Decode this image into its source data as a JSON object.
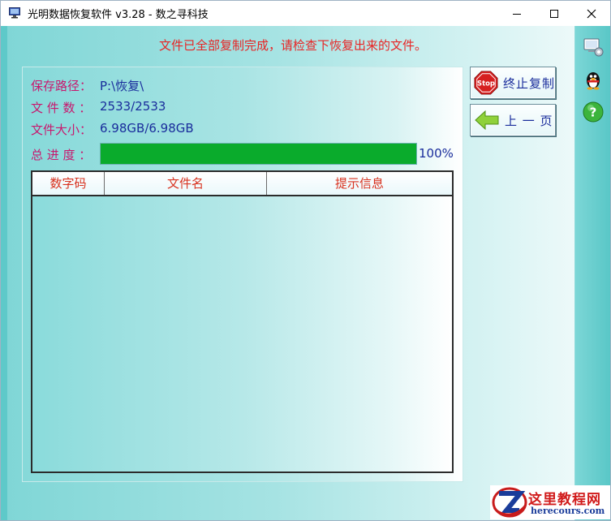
{
  "window": {
    "title": "光明数据恢复软件 v3.28 - 数之寻科技"
  },
  "status_message": "文件已全部复制完成，请检查下恢复出来的文件。",
  "info": {
    "save_path_label": "保存路径：",
    "save_path_value": "P:\\恢复\\",
    "file_count_label": "文 件 数 ：",
    "file_count_value": "2533/2533",
    "file_size_label": "文件大小：",
    "file_size_value": "6.98GB/6.98GB",
    "progress_label": "总 进 度 ：",
    "progress_percent": 100,
    "progress_text": "100%"
  },
  "table": {
    "columns": [
      "数字码",
      "文件名",
      "提示信息"
    ],
    "rows": []
  },
  "buttons": {
    "stop_label": "终止复制",
    "stop_icon_text": "Stop",
    "prev_label": "上 一 页"
  },
  "watermark": {
    "cn": "这里教程网",
    "en": "herecours.com"
  },
  "colors": {
    "status_red": "#e82424",
    "label_magenta": "#c8186e",
    "value_blue": "#1a2d9c",
    "progress_green": "#0aab2c",
    "header_red": "#d8321f"
  }
}
